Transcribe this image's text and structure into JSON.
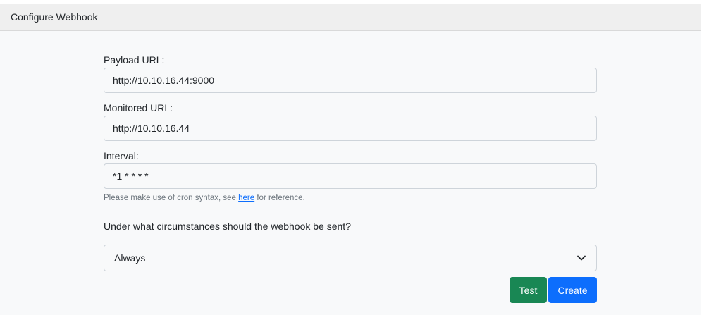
{
  "card": {
    "title": "Configure Webhook"
  },
  "form": {
    "payload_url_label": "Payload URL:",
    "payload_url_value": "http://10.10.16.44:9000",
    "monitored_url_label": "Monitored URL:",
    "monitored_url_value": "http://10.10.16.44",
    "interval_label": "Interval:",
    "interval_value": "*1 * * * *",
    "help_prefix": "Please make use of cron syntax, see ",
    "help_link": "here",
    "help_suffix": " for reference.",
    "question": "Under what circumstances should the webhook be sent?",
    "condition_selected": "Always",
    "condition_icon": "chevron-down-icon"
  },
  "buttons": {
    "test_label": "Test",
    "create_label": "Create"
  },
  "colors": {
    "test_button": "#198754",
    "create_button": "#0d6efd",
    "link": "#0d6efd"
  }
}
